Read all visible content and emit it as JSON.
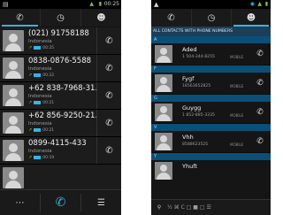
{
  "left": {
    "status": {
      "left_icon": "image-icon",
      "time": "00:25",
      "network": "4G"
    },
    "tabs": [
      {
        "icon": "phone-icon",
        "active": true
      },
      {
        "icon": "clock-icon",
        "active": false
      },
      {
        "icon": "contacts-icon",
        "active": false
      }
    ],
    "calls": [
      {
        "number": "(021) 91758188",
        "location": "Indonesia",
        "time": "00:25"
      },
      {
        "number": "0838-0876-5588",
        "location": "Indonesia",
        "time": "00:22"
      },
      {
        "number": "+62 838-7968-31...",
        "location": "Indonesia",
        "time": "00:21"
      },
      {
        "number": "+62 856-9250-21...",
        "location": "Indonesia",
        "time": "00:21"
      },
      {
        "number": "0899-4115-433",
        "location": "Indonesia",
        "time": "00:19"
      }
    ],
    "bottom": {
      "dialpad_icon": "dialpad-icon",
      "phone_icon": "phone-icon",
      "menu_icon": "menu-icon"
    }
  },
  "right": {
    "status": {
      "left_icon": "upload-icon",
      "time": ""
    },
    "tabs": [
      {
        "icon": "phone-icon",
        "active": false
      },
      {
        "icon": "clock-icon",
        "active": false
      },
      {
        "icon": "contacts-icon",
        "active": true
      }
    ],
    "header": "ALL CONTACTS WITH PHONE NUMBERS",
    "sections": [
      {
        "letter": "A",
        "contacts": [
          {
            "name": "Aded",
            "phone": "1 504-344-8255",
            "type": "MOBILE"
          }
        ]
      },
      {
        "letter": "F",
        "contacts": [
          {
            "name": "Fygf",
            "phone": "18563652825",
            "type": "MOBILE"
          }
        ]
      },
      {
        "letter": "G",
        "contacts": [
          {
            "name": "Guygg",
            "phone": "1 852-885-3335",
            "type": "MOBILE"
          }
        ]
      },
      {
        "letter": "V",
        "contacts": [
          {
            "name": "Vhh",
            "phone": "8588623525",
            "type": "MOBILE"
          }
        ]
      },
      {
        "letter": "Y",
        "contacts": [
          {
            "name": "Yhuft",
            "phone": "",
            "type": ""
          }
        ]
      }
    ],
    "bottom": {
      "search_icon": "search-icon",
      "alphabet": "½  ⌘ C  □ ■  □  ☰"
    }
  }
}
